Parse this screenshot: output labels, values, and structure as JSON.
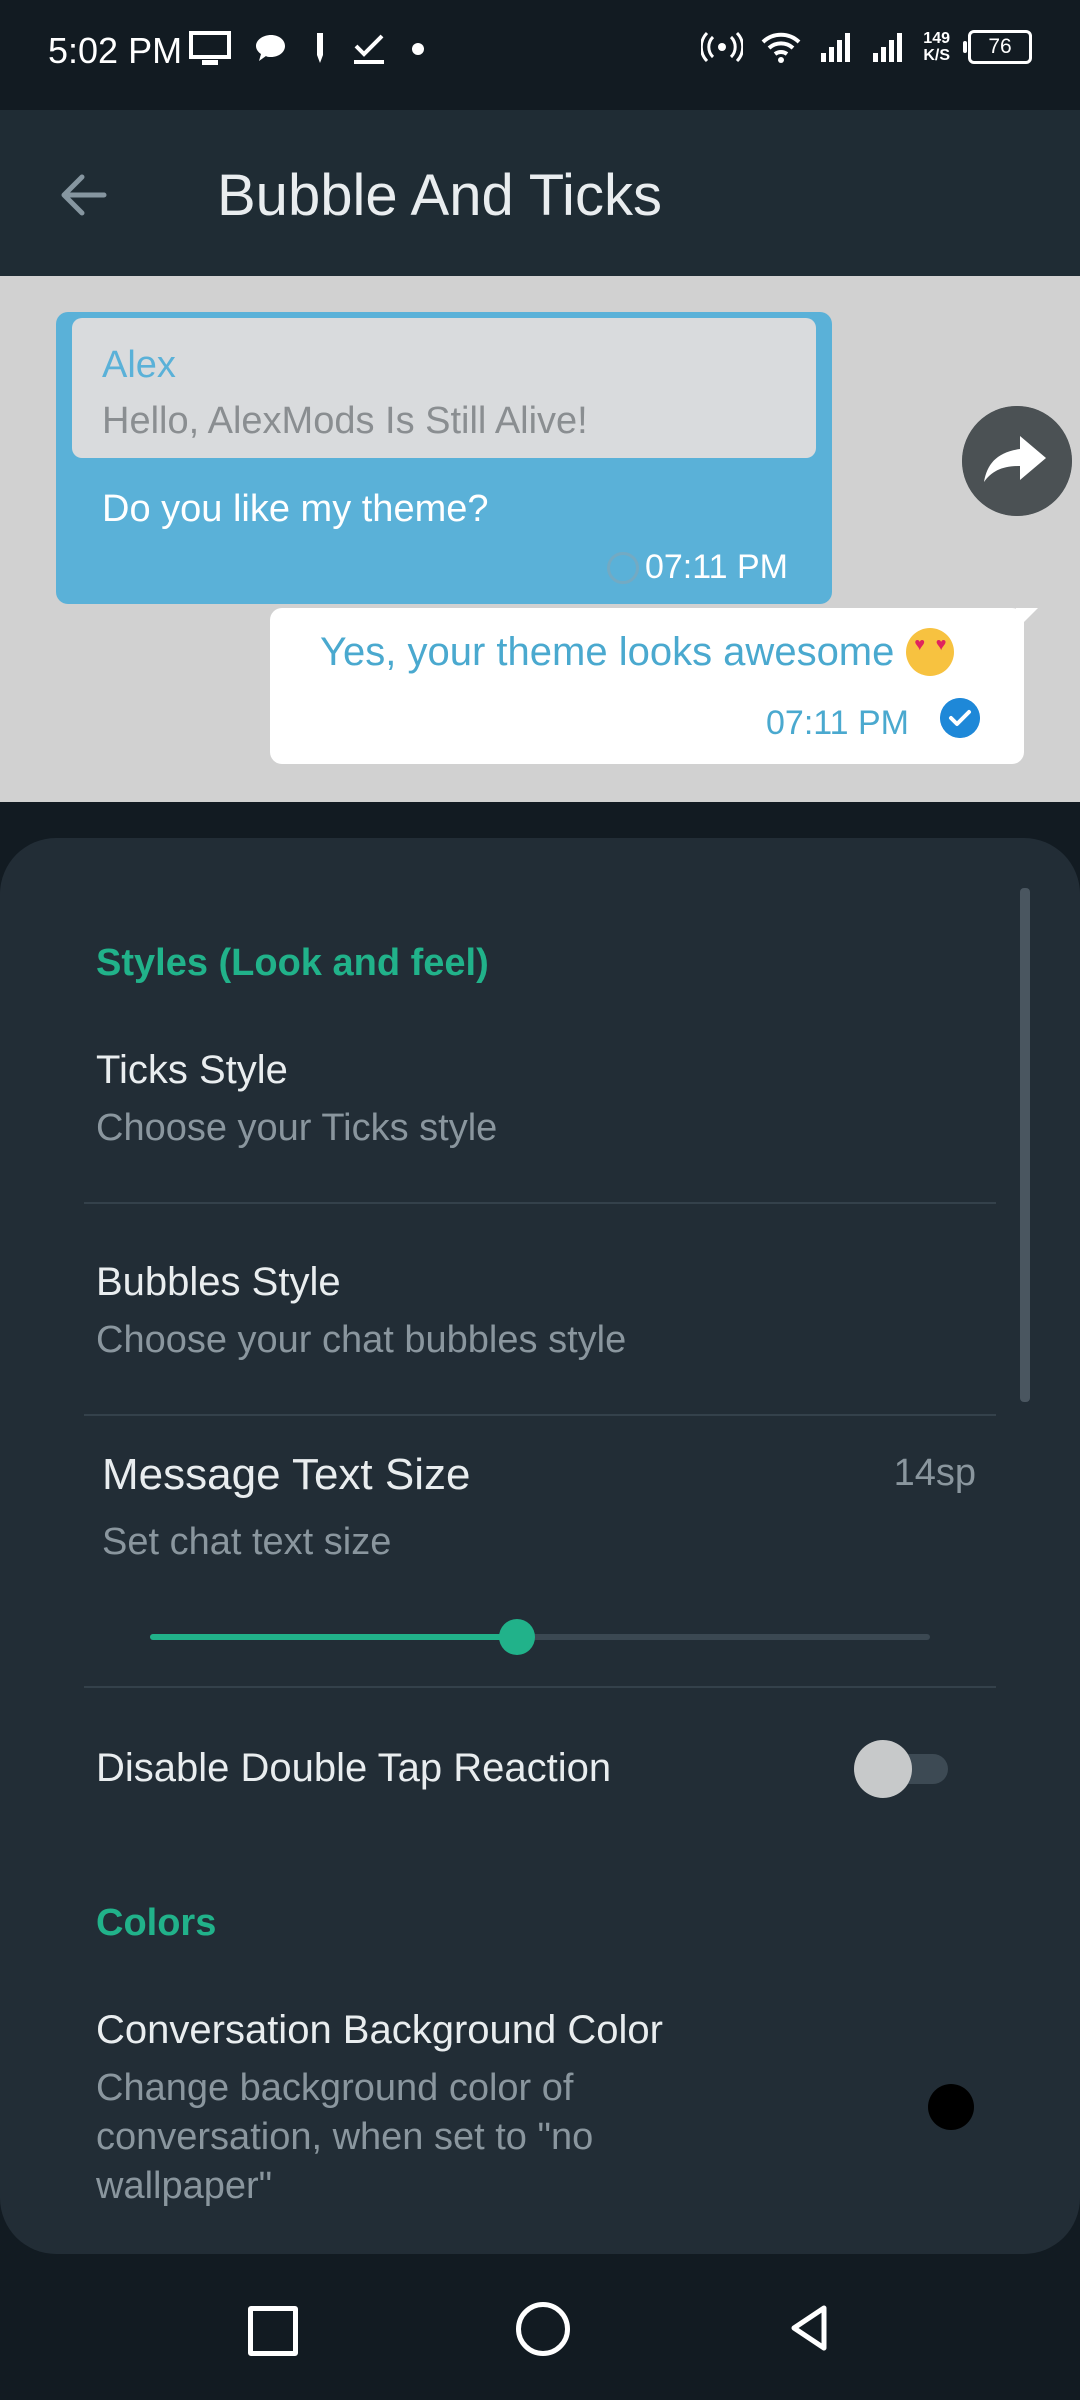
{
  "status_bar": {
    "time": "5:02 PM",
    "speed_value": "149",
    "speed_unit": "K/S",
    "battery": "76",
    "icons": [
      "monitor-icon",
      "chat-icon",
      "pen-icon",
      "check-icon",
      "dot-icon",
      "hotspot-icon",
      "wifi-icon",
      "signal-icon",
      "signal-icon"
    ]
  },
  "appbar": {
    "title": "Bubble And Ticks"
  },
  "preview": {
    "incoming": {
      "quote_name": "Alex",
      "quote_text": "Hello, AlexMods Is Still Alive!",
      "text": "Do you like my theme?",
      "time": "07:11 PM"
    },
    "outgoing": {
      "text": "Yes, your theme looks awesome",
      "time": "07:11 PM"
    }
  },
  "settings": {
    "section_styles": "Styles (Look and feel)",
    "ticks_title": "Ticks Style",
    "ticks_sub": "Choose your Ticks style",
    "bubbles_title": "Bubbles Style",
    "bubbles_sub": "Choose your chat bubbles style",
    "text_size_title": "Message Text Size",
    "text_size_sub": "Set chat text size",
    "text_size_value": "14sp",
    "text_size_slider_fraction": 0.47,
    "double_tap_title": "Disable Double Tap Reaction",
    "double_tap_enabled": false,
    "section_colors": "Colors",
    "conv_bg_title": "Conversation Background Color",
    "conv_bg_sub": "Change background color of conversation, when set to \"no wallpaper\"",
    "conv_bg_color": "#000000"
  },
  "colors": {
    "accent": "#21b28a",
    "incoming_bubble": "#5ab1d8",
    "outgoing_text": "#4aa9cf"
  }
}
